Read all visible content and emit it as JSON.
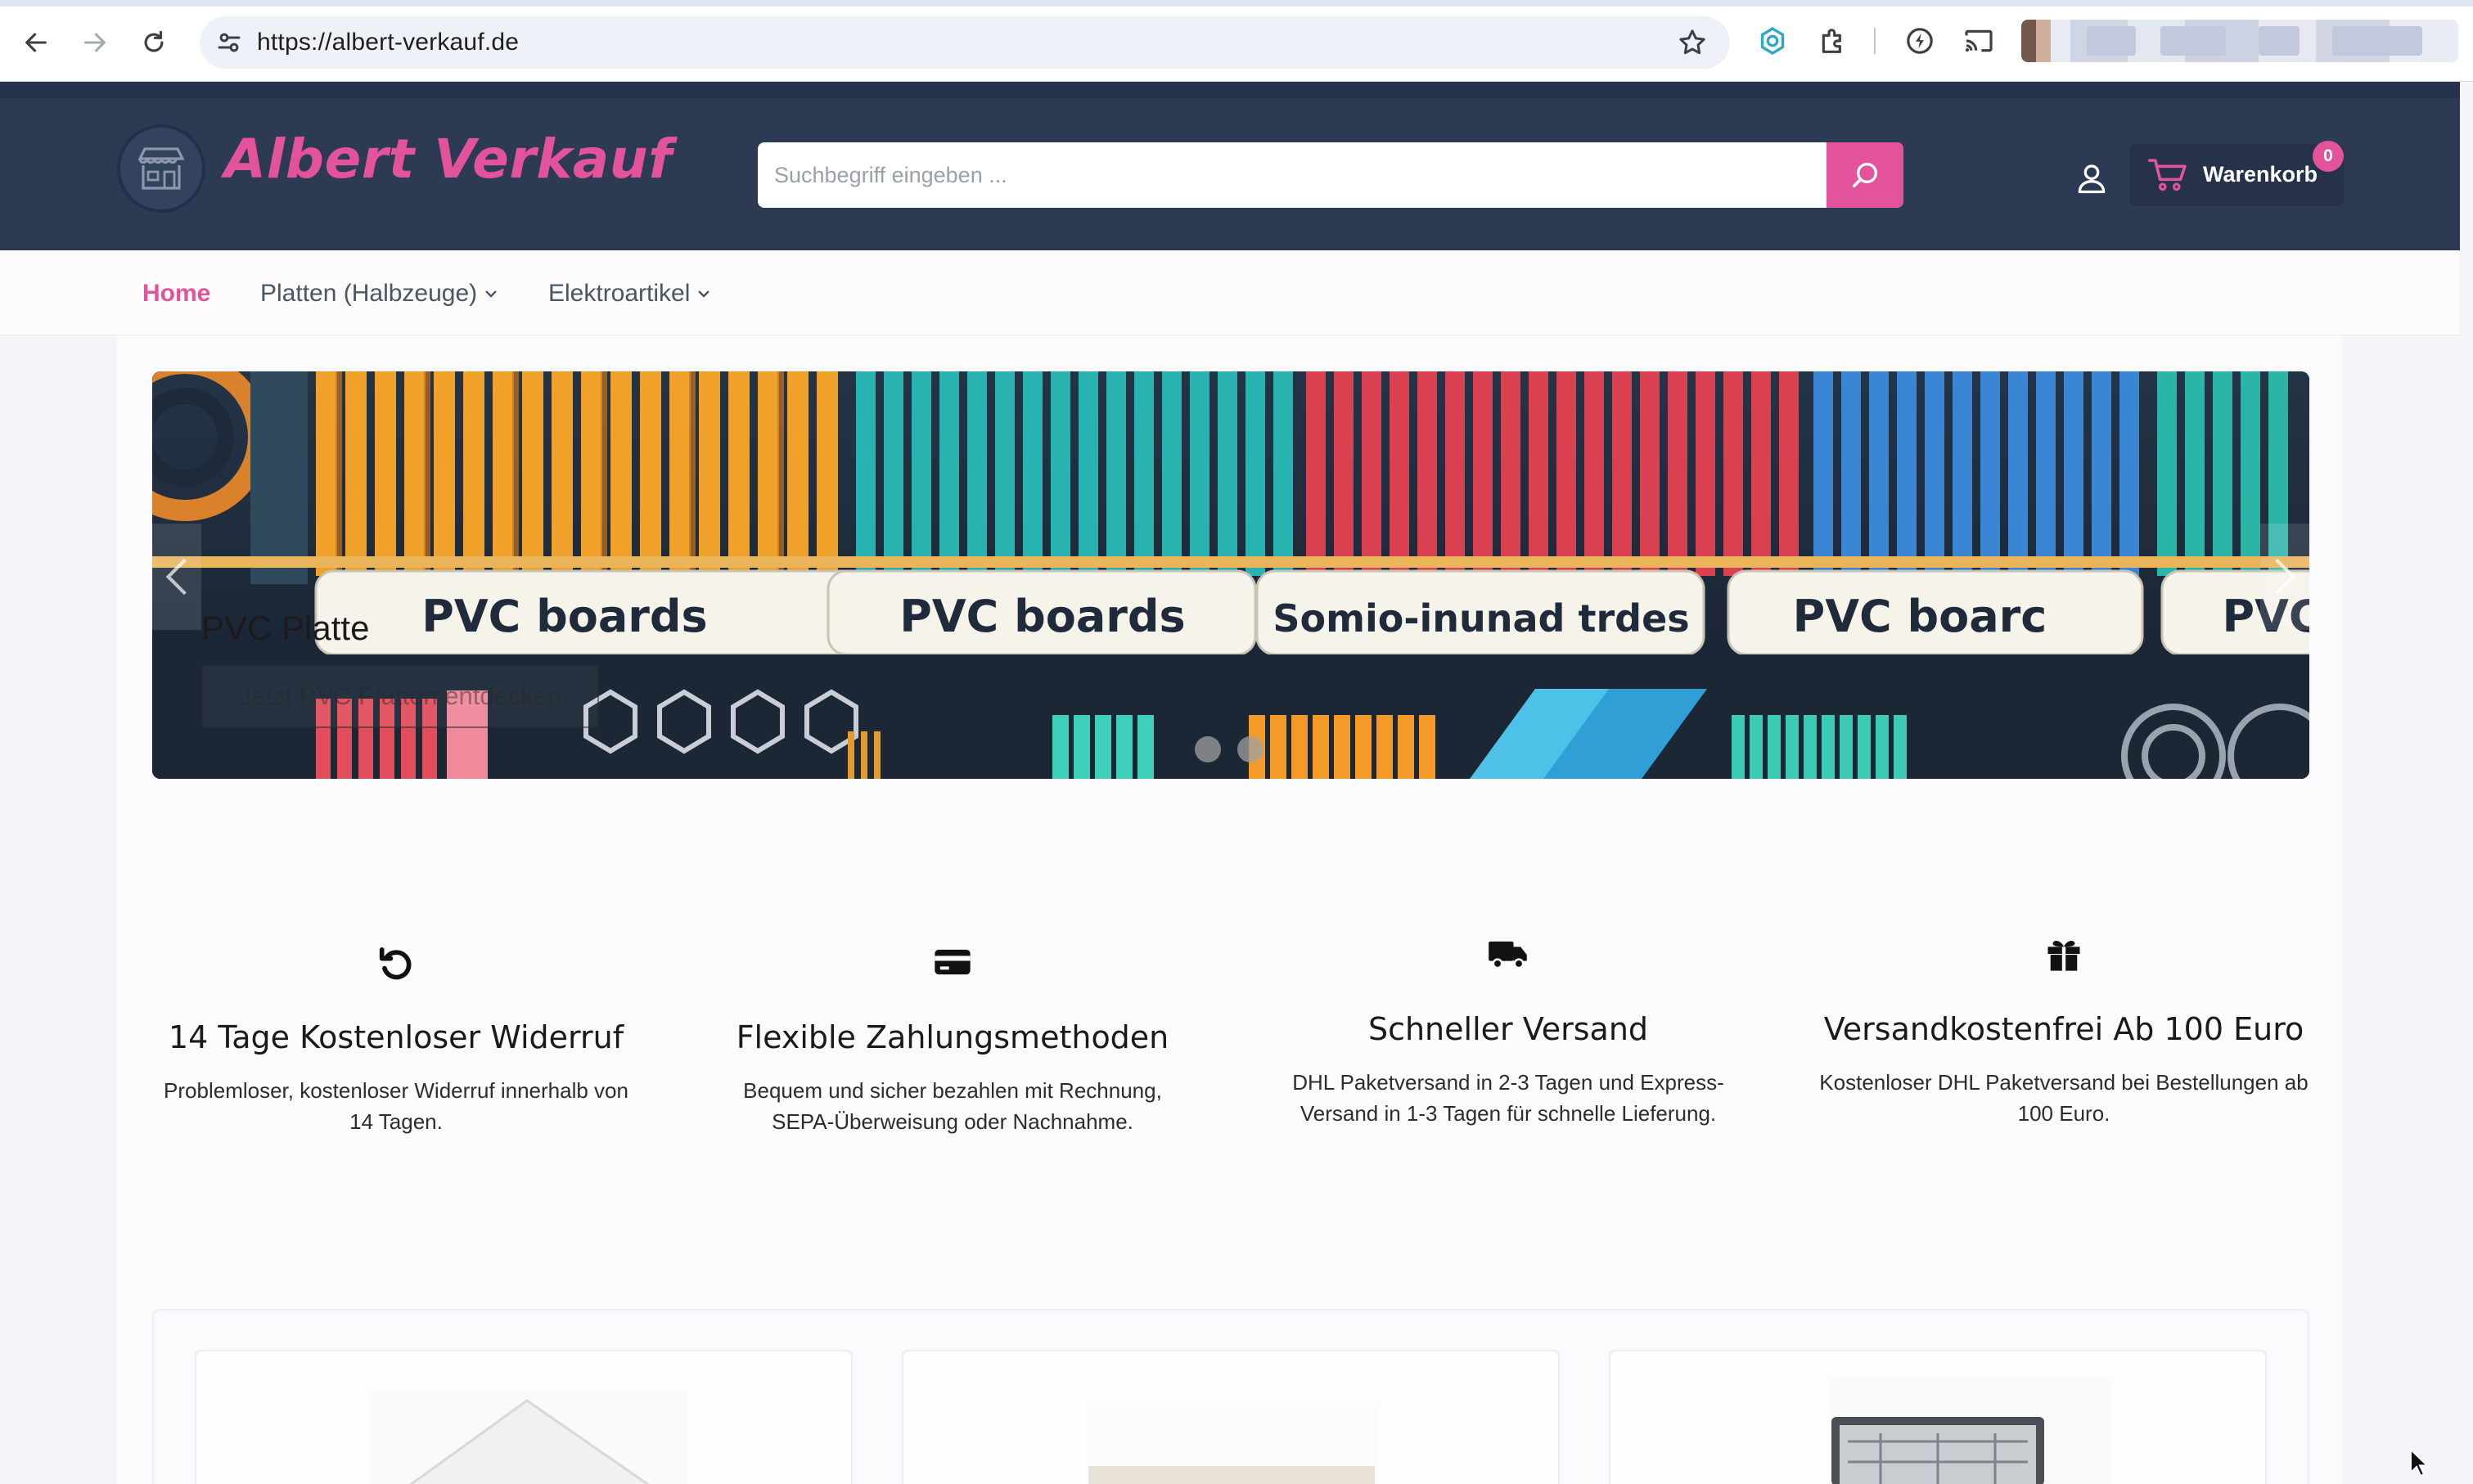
{
  "browser": {
    "url": "https://albert-verkauf.de",
    "icons": [
      "back-icon",
      "forward-icon",
      "reload-icon",
      "site-settings-icon",
      "bookmark-star-icon",
      "extension-icon",
      "puzzle-icon",
      "bolt-icon",
      "cast-icon"
    ]
  },
  "header": {
    "logo_text": "Albert Verkauf",
    "search_placeholder": "Suchbegriff eingeben ...",
    "cart_label": "Warenkorb",
    "cart_count": "0"
  },
  "nav": {
    "items": [
      {
        "label": "Home",
        "active": true
      },
      {
        "label": "Platten (Halbzeuge)",
        "dropdown": true
      },
      {
        "label": "Elektroartikel",
        "dropdown": true
      }
    ]
  },
  "hero": {
    "slide_title": "PVC Platte",
    "slide_button": "Jetzt PVC Platten entdecken",
    "image_labels": [
      "PVC boards",
      "PVC boards",
      "Somio-inunad trdes",
      "PVC boarc",
      "PVC"
    ],
    "slide_count": 2
  },
  "features": [
    {
      "icon": "undo-icon",
      "title": "14 Tage Kostenloser Widerruf",
      "desc_line1": "Problemloser, kostenloser Widerruf innerhalb von",
      "desc_line2": "14 Tagen."
    },
    {
      "icon": "credit-card-icon",
      "title": "Flexible Zahlungsmethoden",
      "desc_line1": "Bequem und sicher bezahlen mit Rechnung,",
      "desc_line2": "SEPA-Überweisung oder Nachnahme."
    },
    {
      "icon": "truck-icon",
      "title": "Schneller Versand",
      "desc_line1": "DHL Paketversand in 2-3 Tagen und Express-",
      "desc_line2": "Versand in 1-3 Tagen für schnelle Lieferung."
    },
    {
      "icon": "gift-icon",
      "title": "Versandkostenfrei Ab 100 Euro",
      "desc_line1": "Kostenloser DHL Paketversand bei Bestellungen ab",
      "desc_line2": "100 Euro."
    }
  ],
  "colors": {
    "brand_pink": "#e2539b",
    "header_navy": "#2c3a53"
  }
}
